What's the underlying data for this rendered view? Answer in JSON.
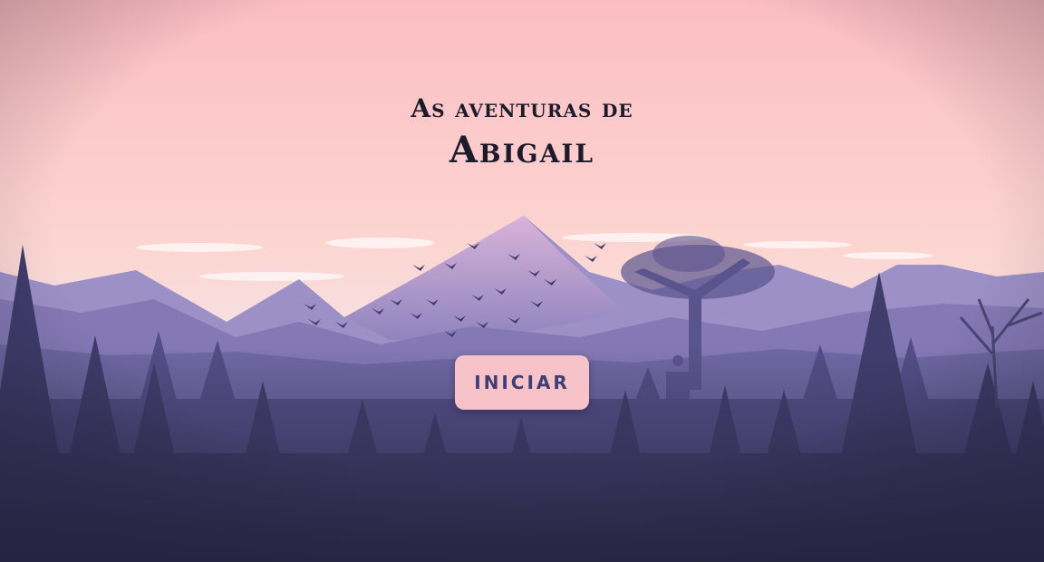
{
  "game": {
    "title_line1": "As aventuras de",
    "title_line2": "Abigail",
    "start_label": "INICIAR"
  },
  "colors": {
    "sky_top": "#fbbdc2",
    "sky_bottom": "#fbd9d4",
    "far_mountains": "#9b8fc6",
    "mid_mountains": "#7a72ad",
    "forest": "#4a4777",
    "foreground": "#2c2a4a",
    "button_bg": "#f8c3c8",
    "button_text": "#3f3f74",
    "title_text": "#1d1a2c"
  }
}
